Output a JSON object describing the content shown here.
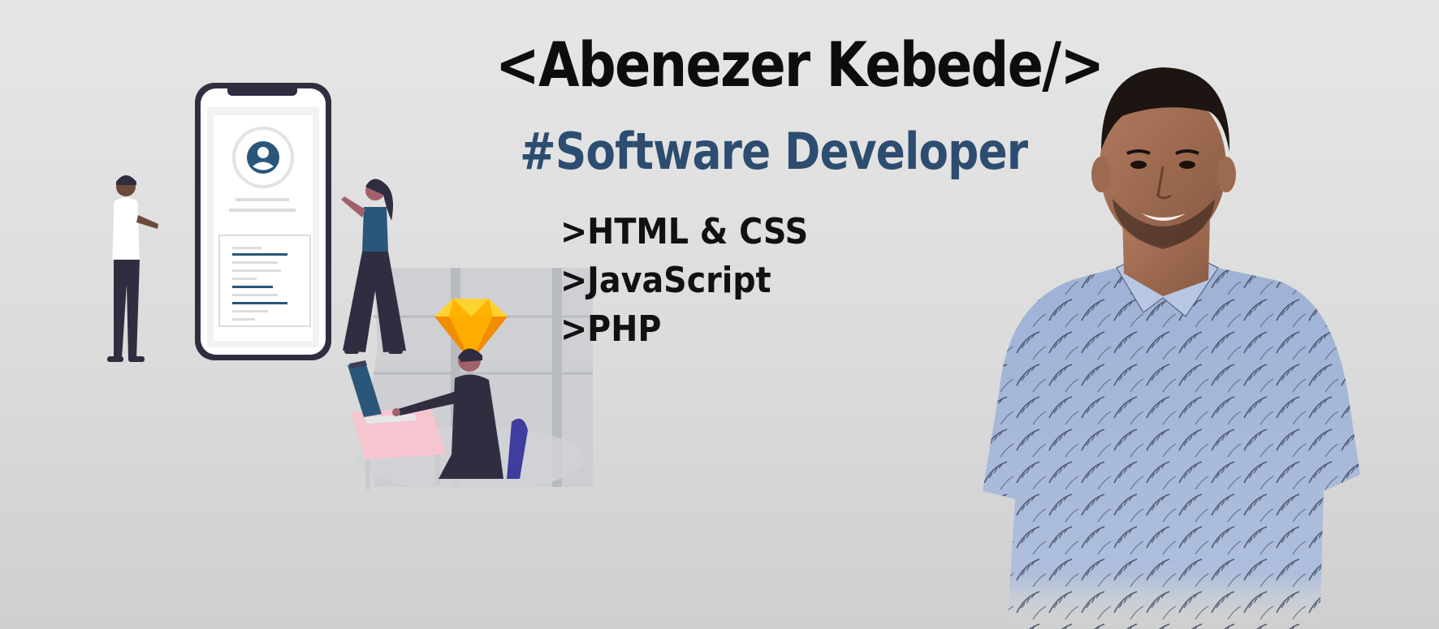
{
  "banner": {
    "name": "<Abenezer Kebede/>",
    "role": "#Software Developer",
    "skills": [
      ">HTML & CSS",
      ">JavaScript",
      ">PHP"
    ]
  },
  "colors": {
    "name_text": "#0d0d0d",
    "role_text": "#2d4d70",
    "accent_blue": "#2a5779",
    "sketch_gem": "#f5b62e",
    "background": "#dedede"
  },
  "illustration": {
    "icons": [
      "phone-mockup",
      "user-avatar-icon",
      "person-standing",
      "person-pointing",
      "sketch-gem-icon",
      "person-at-laptop"
    ]
  },
  "portrait": {
    "subject": "portrait-photo"
  }
}
